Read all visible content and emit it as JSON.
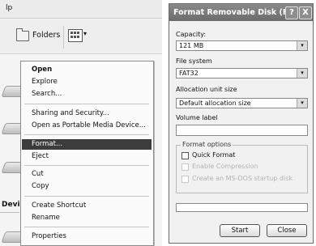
{
  "explorer": {
    "menubar_text": "lp",
    "toolbar": {
      "folders_label": "Folders",
      "view_caret": "▾"
    },
    "section_label": "Devi"
  },
  "context_menu": {
    "items": [
      {
        "label": "Open",
        "bold": true
      },
      {
        "label": "Explore"
      },
      {
        "label": "Search..."
      },
      {
        "label": "Sharing and Security..."
      },
      {
        "label": "Open as Portable Media Device..."
      },
      {
        "label": "Format...",
        "highlighted": true
      },
      {
        "label": "Eject"
      },
      {
        "label": "Cut"
      },
      {
        "label": "Copy"
      },
      {
        "label": "Create Shortcut"
      },
      {
        "label": "Rename"
      },
      {
        "label": "Properties"
      }
    ]
  },
  "dialog": {
    "title": "Format Removable Disk (F:)",
    "help_glyph": "?",
    "close_glyph": "X",
    "capacity_label": "Capacity:",
    "capacity_value": "121 MB",
    "filesystem_label": "File system",
    "filesystem_value": "FAT32",
    "alloc_label": "Allocation unit size",
    "alloc_value": "Default allocation size",
    "volume_label": "Volume label",
    "volume_value": "",
    "options_title": "Format options",
    "quick_format": "Quick Format",
    "enable_compression": "Enable Compression",
    "msdos_disk": "Create an MS-DOS startup disk",
    "progress_fraction": 0,
    "start_label": "Start",
    "close_label": "Close",
    "dropdown_glyph": "▾"
  }
}
